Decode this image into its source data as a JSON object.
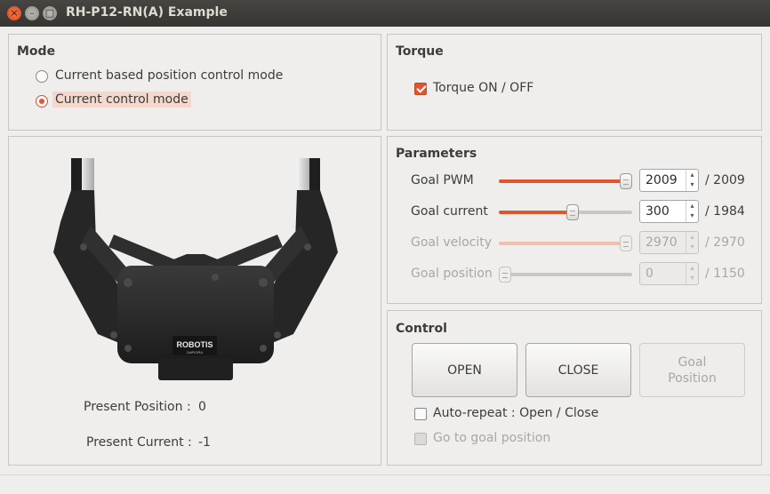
{
  "window": {
    "title": "RH-P12-RN(A) Example",
    "close_glyph": "×",
    "min_glyph": "–",
    "max_glyph": "□"
  },
  "mode": {
    "title": "Mode",
    "options": [
      {
        "label": "Current based position control mode",
        "selected": false
      },
      {
        "label": "Current control mode",
        "selected": true
      }
    ]
  },
  "torque": {
    "title": "Torque",
    "checkbox_label": "Torque ON / OFF",
    "checked": true
  },
  "image_panel": {
    "logo_text": "ROBOTIS",
    "logo_sub": "DAPIORA",
    "present_position_label": "Present Position :",
    "present_position_value": "0",
    "present_current_label": "Present Current :",
    "present_current_value": "-1"
  },
  "parameters": {
    "title": "Parameters",
    "rows": [
      {
        "label": "Goal PWM",
        "value": "2009",
        "max_label": "/ 2009",
        "fraction": 1.0,
        "enabled": true,
        "up": "▴",
        "down": "▾"
      },
      {
        "label": "Goal current",
        "value": "300",
        "max_label": "/ 1984",
        "fraction": 0.56,
        "enabled": true,
        "up": "▴",
        "down": "▾"
      },
      {
        "label": "Goal velocity",
        "value": "2970",
        "max_label": "/ 2970",
        "fraction": 1.0,
        "enabled": false,
        "up": "▴",
        "down": "▾"
      },
      {
        "label": "Goal position",
        "value": "0",
        "max_label": "/ 1150",
        "fraction": 0.0,
        "enabled": false,
        "up": "▴",
        "down": "▾"
      }
    ]
  },
  "control": {
    "title": "Control",
    "open_label": "OPEN",
    "close_label": "CLOSE",
    "goal_position_line1": "Goal",
    "goal_position_line2": "Position",
    "auto_repeat_label": "Auto-repeat : Open / Close",
    "auto_repeat_checked": false,
    "go_to_goal_label": "Go to goal position",
    "go_to_goal_enabled": false
  },
  "colors": {
    "accent": "#e1562e",
    "titlebar": "#3d3c38",
    "window_bg": "#efeeec"
  }
}
